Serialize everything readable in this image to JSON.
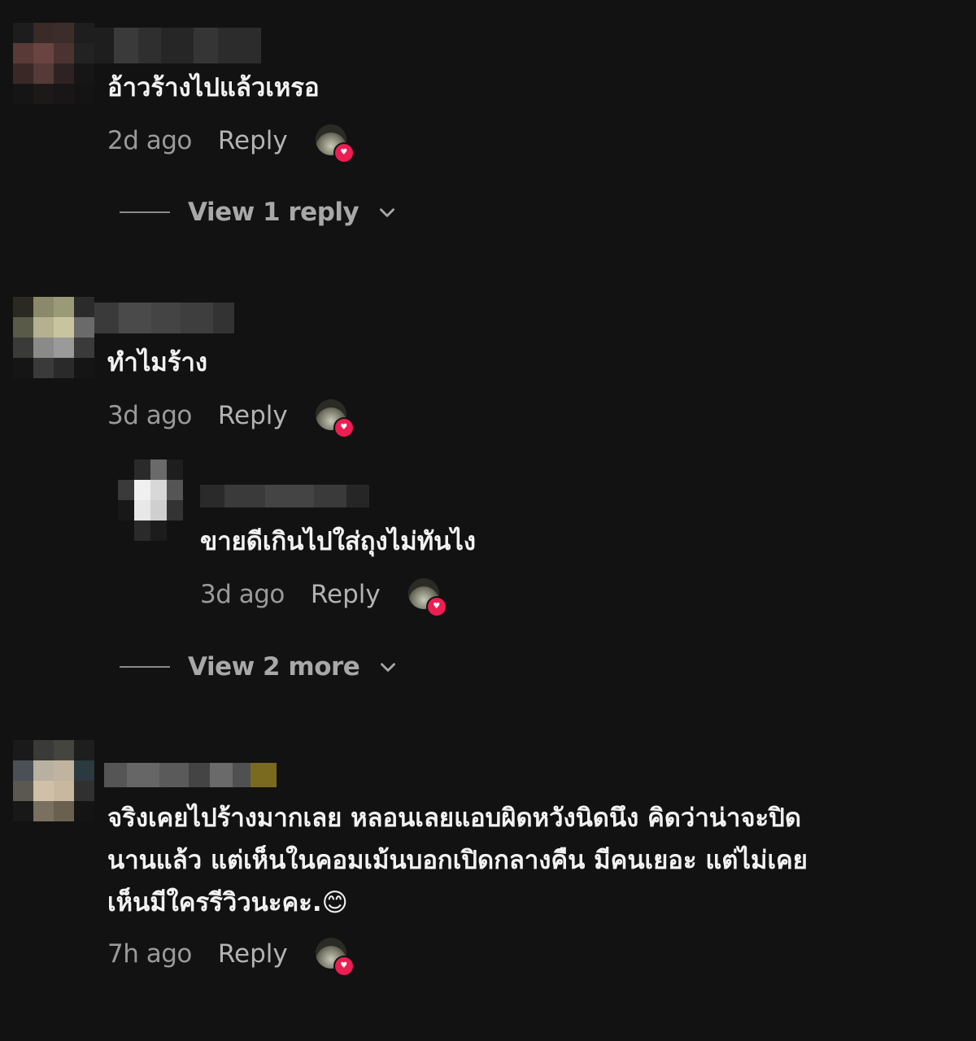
{
  "comments": [
    {
      "text": "อ้าวร้างไปแล้วเหรอ",
      "time": "2d ago",
      "reply_label": "Reply",
      "view_replies_label": "View 1 reply"
    },
    {
      "text": "ทำไมร้าง",
      "time": "3d ago",
      "reply_label": "Reply",
      "reply": {
        "text": "ขายดีเกินไปใส่ถุงไม่ทันไง",
        "time": "3d ago",
        "reply_label": "Reply"
      },
      "view_more_label": "View 2 more"
    },
    {
      "text_lines": [
        "จริงเคยไปร้างมากเลย หลอนเลยแอบผิดหวังนิดนึง คิดว่าน่าจะปิด",
        "นานแล้ว แต่เห็นในคอมเม้นบอกเปิดกลางคืน มีคนเยอะ แต่ไม่เคย",
        "เห็นมีใครรีวิวนะคะ."
      ],
      "emoji": "😊",
      "time": "7h ago",
      "reply_label": "Reply"
    }
  ],
  "icons": {
    "creator_like": "creator-liked-heart-icon",
    "chevron": "chevron-down-icon"
  },
  "colors": {
    "background": "#121212",
    "text": "#f2f2f2",
    "muted": "#9a9a9a",
    "heart": "#ee1d52"
  }
}
